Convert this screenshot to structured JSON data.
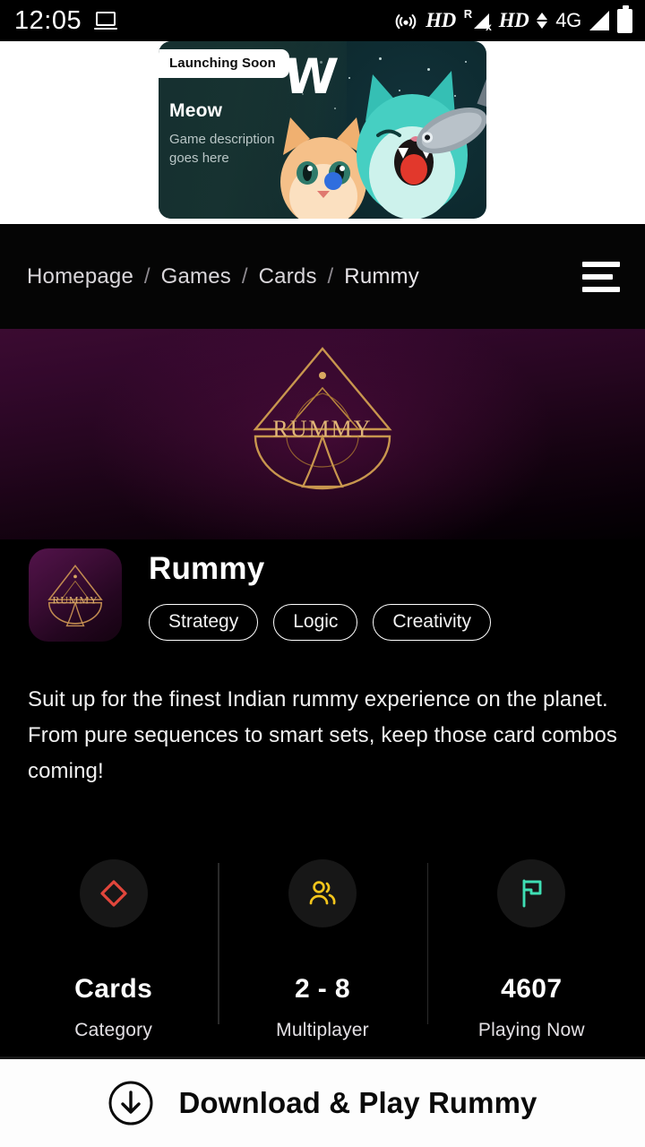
{
  "status_bar": {
    "time": "12:05",
    "icons": [
      "laptop-icon",
      "hotspot-icon",
      "hd-icon",
      "roaming-signal-off-icon",
      "hd-icon-2",
      "data-transfer-4g-icon",
      "signal-bars-icon",
      "battery-icon"
    ],
    "hd_label": "HD",
    "hd_label_2": "HD",
    "network_label": "4G",
    "roaming_label": "R",
    "signal_off_label": "x"
  },
  "promo": {
    "badge": "Launching Soon",
    "title": "Meow",
    "subtitle": "Game description goes here",
    "brand_mark": "W",
    "bg_color": "#0d2a2f"
  },
  "breadcrumb": {
    "items": [
      "Homepage",
      "Games",
      "Cards",
      "Rummy"
    ],
    "separator": "/",
    "menu_icon": "hamburger-menu-icon"
  },
  "hero": {
    "logo_text": "RUMMY",
    "gradient_from": "#3b0b31",
    "gradient_to": "#020002"
  },
  "game": {
    "icon_text": "RUMMY",
    "title": "Rummy",
    "tags": [
      "Strategy",
      "Logic",
      "Creativity"
    ],
    "description": "Suit up for the finest Indian rummy experience on the planet. From pure sequences to smart sets, keep those card combos coming!"
  },
  "stats": [
    {
      "icon": "diamond-suit-icon",
      "icon_color": "#e2463c",
      "value": "Cards",
      "label": "Category"
    },
    {
      "icon": "users-multiplayer-icon",
      "icon_color": "#f3c51c",
      "value": "2 - 8",
      "label": "Multiplayer"
    },
    {
      "icon": "flag-icon",
      "icon_color": "#3fdfb4",
      "value": "4607",
      "label": "Playing Now"
    }
  ],
  "cta": {
    "icon": "download-circle-icon",
    "label": "Download & Play Rummy"
  }
}
